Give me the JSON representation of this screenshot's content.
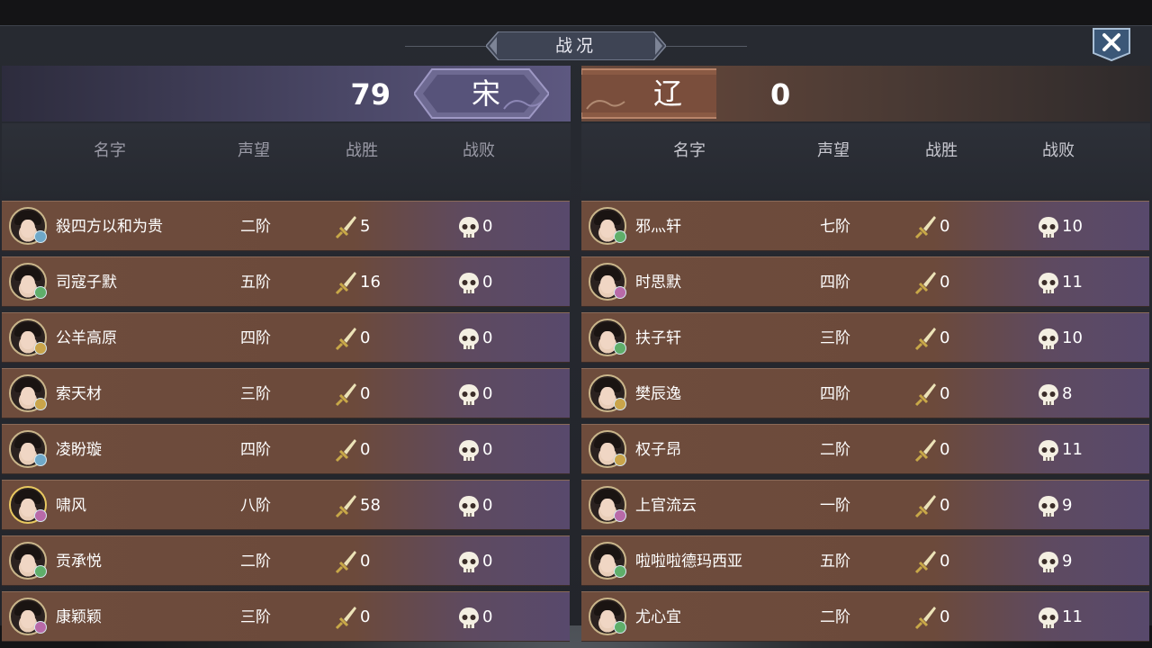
{
  "title": "战况",
  "close_label": "close",
  "song": {
    "faction_name": "宋",
    "score": "79",
    "headers": {
      "name": "名字",
      "rank": "声望",
      "win": "战胜",
      "lose": "战败"
    },
    "players": [
      {
        "name": "殺四方以和为贵",
        "rank": "二阶",
        "wins": "5",
        "losses": "0"
      },
      {
        "name": "司寇子默",
        "rank": "五阶",
        "wins": "16",
        "losses": "0"
      },
      {
        "name": "公羊高原",
        "rank": "四阶",
        "wins": "0",
        "losses": "0"
      },
      {
        "name": "索天材",
        "rank": "三阶",
        "wins": "0",
        "losses": "0"
      },
      {
        "name": "凌盼璇",
        "rank": "四阶",
        "wins": "0",
        "losses": "0"
      },
      {
        "name": "啸风",
        "rank": "八阶",
        "wins": "58",
        "losses": "0"
      },
      {
        "name": "贡承悦",
        "rank": "二阶",
        "wins": "0",
        "losses": "0"
      },
      {
        "name": "康颖颖",
        "rank": "三阶",
        "wins": "0",
        "losses": "0"
      }
    ]
  },
  "liao": {
    "faction_name": "辽",
    "score": "0",
    "headers": {
      "name": "名字",
      "rank": "声望",
      "win": "战胜",
      "lose": "战败"
    },
    "players": [
      {
        "name": "邪灬轩",
        "rank": "七阶",
        "wins": "0",
        "losses": "10"
      },
      {
        "name": "时思默",
        "rank": "四阶",
        "wins": "0",
        "losses": "11"
      },
      {
        "name": "扶子轩",
        "rank": "三阶",
        "wins": "0",
        "losses": "10"
      },
      {
        "name": "樊辰逸",
        "rank": "四阶",
        "wins": "0",
        "losses": "8"
      },
      {
        "name": "权子昂",
        "rank": "二阶",
        "wins": "0",
        "losses": "11"
      },
      {
        "name": "上官流云",
        "rank": "一阶",
        "wins": "0",
        "losses": "9"
      },
      {
        "name": "啦啦啦德玛西亚",
        "rank": "五阶",
        "wins": "0",
        "losses": "9"
      },
      {
        "name": "尤心宜",
        "rank": "二阶",
        "wins": "0",
        "losses": "11"
      }
    ]
  },
  "colors": {
    "song_header": "#5d5880",
    "liao_header": "#6b4a3c",
    "row_brown": "#6e4c3c",
    "row_purple": "#58496c",
    "sword": "#e8d48a",
    "skull": "#f4efe2"
  },
  "icons": {
    "win": "sword-icon",
    "loss": "skull-icon",
    "close": "close-icon"
  }
}
